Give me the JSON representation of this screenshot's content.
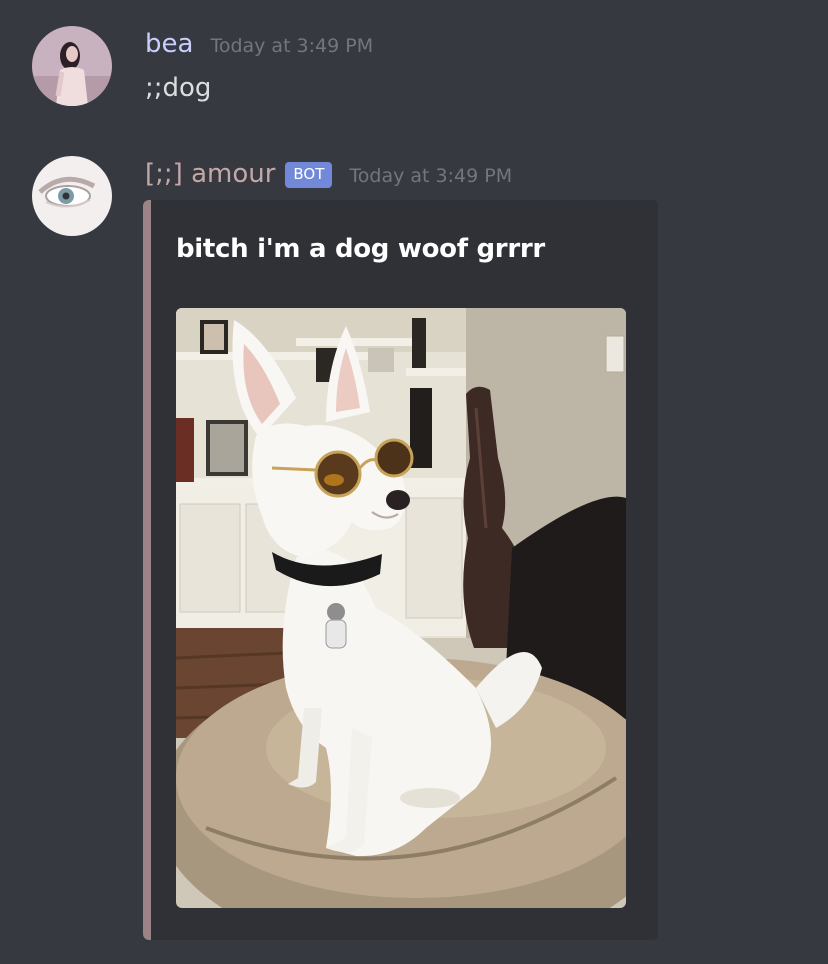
{
  "messages": [
    {
      "author": "bea",
      "author_color": "#c9cdfb",
      "timestamp": "Today at 3:49 PM",
      "content": ";;dog",
      "avatar_icon": "user-avatar-photo"
    },
    {
      "author": "[;;] amour",
      "author_color": "#c4a8a8",
      "bot_tag": "BOT",
      "timestamp": "Today at 3:49 PM",
      "avatar_icon": "eye-avatar-photo",
      "embed": {
        "title": "bitch i'm a dog woof grrrr",
        "accent_color": "#9c8387",
        "image_subject": "white-dog-in-sunglasses-photo"
      }
    }
  ],
  "theme": {
    "background": "#36393f",
    "embed_background": "#2f3136",
    "bot_tag_color": "#7289da",
    "timestamp_color": "#72767d"
  }
}
